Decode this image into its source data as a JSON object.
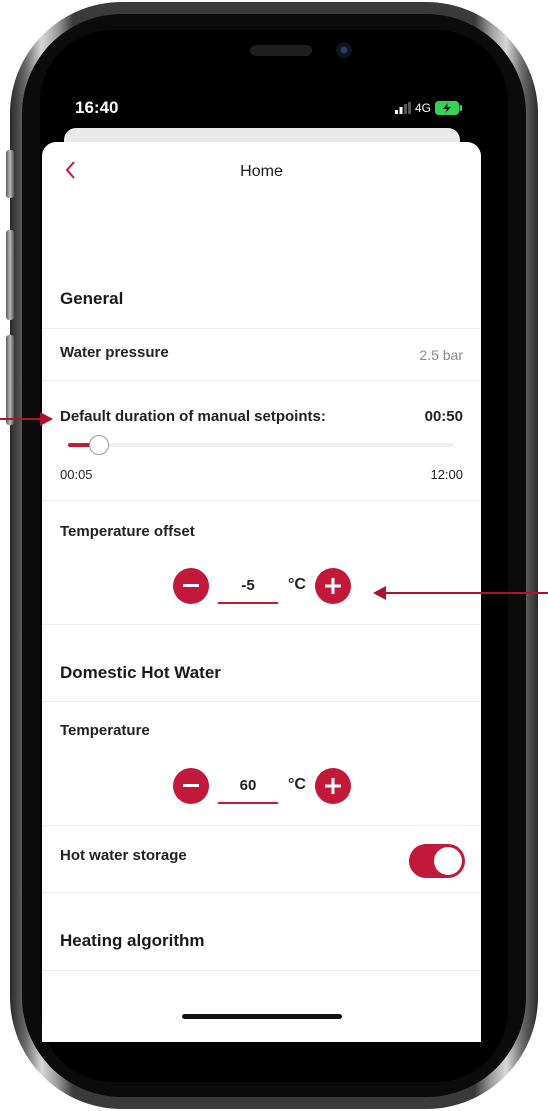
{
  "status_bar": {
    "time": "16:40",
    "network": "4G"
  },
  "header": {
    "title": "Home"
  },
  "general": {
    "title": "General",
    "water_pressure": {
      "label": "Water pressure",
      "value": "2.5 bar"
    },
    "manual_setpoints": {
      "label": "Default duration of manual setpoints:",
      "value": "00:50",
      "min_label": "00:05",
      "max_label": "12:00",
      "slider_fraction": 0.06
    },
    "temperature_offset": {
      "label": "Temperature offset",
      "value": "-5",
      "unit": "°C"
    }
  },
  "dhw": {
    "title": "Domestic Hot Water",
    "temperature": {
      "label": "Temperature",
      "value": "60",
      "unit": "°C"
    },
    "storage": {
      "label": "Hot water storage",
      "enabled": true
    }
  },
  "heating": {
    "title": "Heating algorithm"
  },
  "colors": {
    "accent": "#c2183a",
    "arrow": "#b0122e"
  },
  "icons": {
    "back": "chevron-left-icon",
    "minus": "minus-icon",
    "plus": "plus-icon"
  }
}
